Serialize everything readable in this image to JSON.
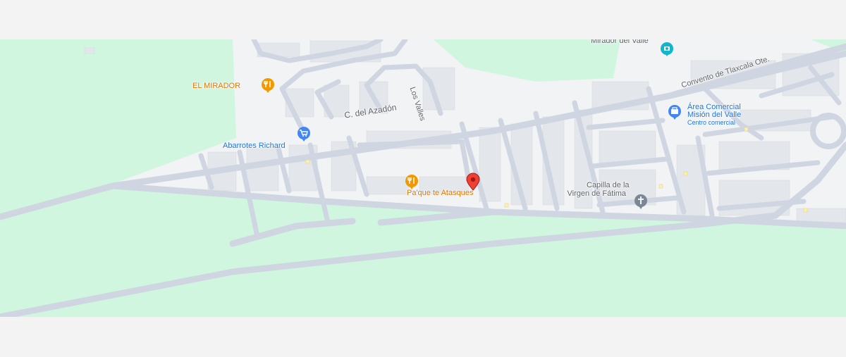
{
  "map": {
    "roads": {
      "azadon": "C. del Azadón",
      "los_valles": "Los Valles",
      "convento": "Convento de Tlaxcala Ote."
    },
    "places": {
      "el_mirador": "EL MIRADOR",
      "mirador_del_valle": "Mirador del Valle",
      "abarrotes": "Abarrotes Richard",
      "paque": "Pa'que te Atasques",
      "area_comercial_1": "Área Comercial",
      "area_comercial_2": "Misión del Valle",
      "area_comercial_sub": "Centro comercial",
      "capilla_1": "Capilla de la",
      "capilla_2": "Virgen de Fátima"
    },
    "icons": {
      "restaurant": "fork-knife-icon",
      "grocery": "shopping-cart-icon",
      "mall": "shopping-bag-icon",
      "church": "cross-icon",
      "selected": "location-pin-icon"
    },
    "colors": {
      "park": "#d1f6e0",
      "urban": "#f1f3f4",
      "road": "#cfd6e2",
      "food": "#f29900",
      "shop": "#4285f4",
      "church": "#7b8794",
      "pin": "#ea4335"
    }
  }
}
